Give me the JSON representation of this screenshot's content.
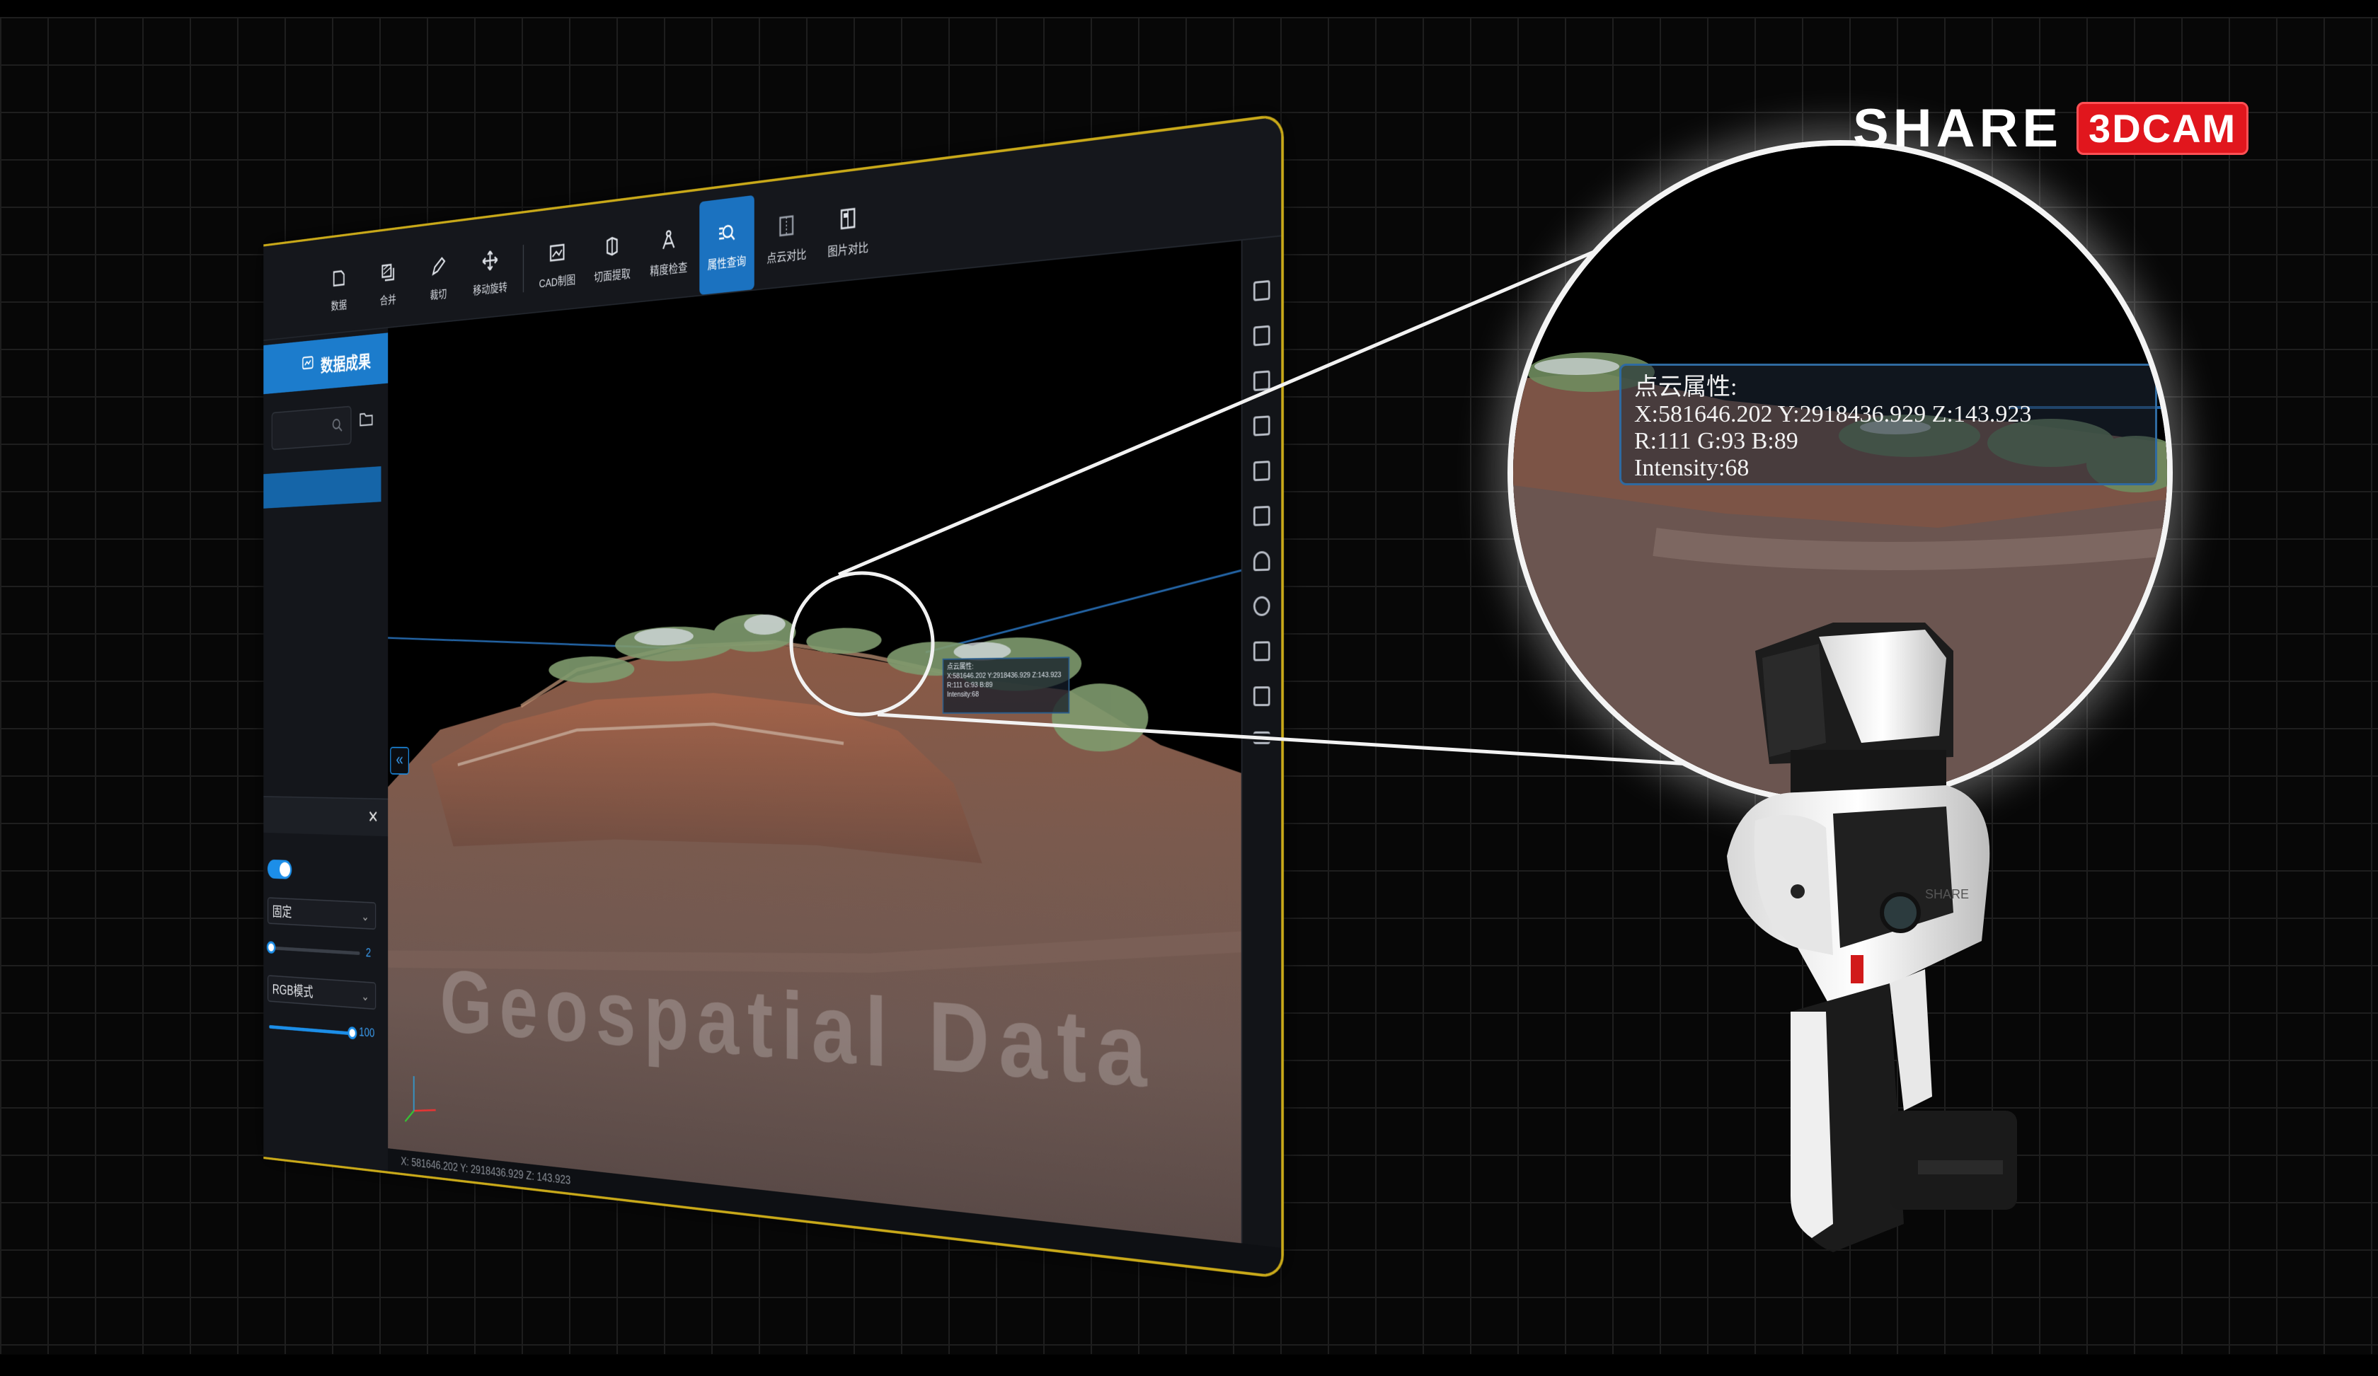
{
  "brand": {
    "name": "SHARE",
    "badge": "3DCAM"
  },
  "toolbar": {
    "items": [
      {
        "label": "数据"
      },
      {
        "label": "合并"
      },
      {
        "label": "裁切"
      },
      {
        "label": "移动旋转"
      },
      {
        "label": "CAD制图"
      },
      {
        "label": "切面提取"
      },
      {
        "label": "精度检查"
      },
      {
        "label": "属性查询"
      },
      {
        "label": "点云对比"
      },
      {
        "label": "图片对比"
      }
    ],
    "active_index": 7
  },
  "sidebar": {
    "tab_label": "数据成果"
  },
  "panel": {
    "select_mode": "固定",
    "point_size_value": "2",
    "color_mode": "RGB模式",
    "opacity_value": "100"
  },
  "overlay_text": "Geospatial Data",
  "point_info": {
    "title": "点云属性:",
    "xyz": "X:581646.202 Y:2918436.929 Z:143.923",
    "rgb": "R:111 G:93 B:89",
    "intensity": "Intensity:68"
  },
  "statusbar": {
    "coords": "X: 581646.202  Y: 2918436.929  Z: 143.923"
  },
  "device": {
    "logo": "SHARE"
  },
  "colors": {
    "accent": "#1c7ccc",
    "frame": "#c9a919",
    "brand_red": "#e1161d"
  }
}
